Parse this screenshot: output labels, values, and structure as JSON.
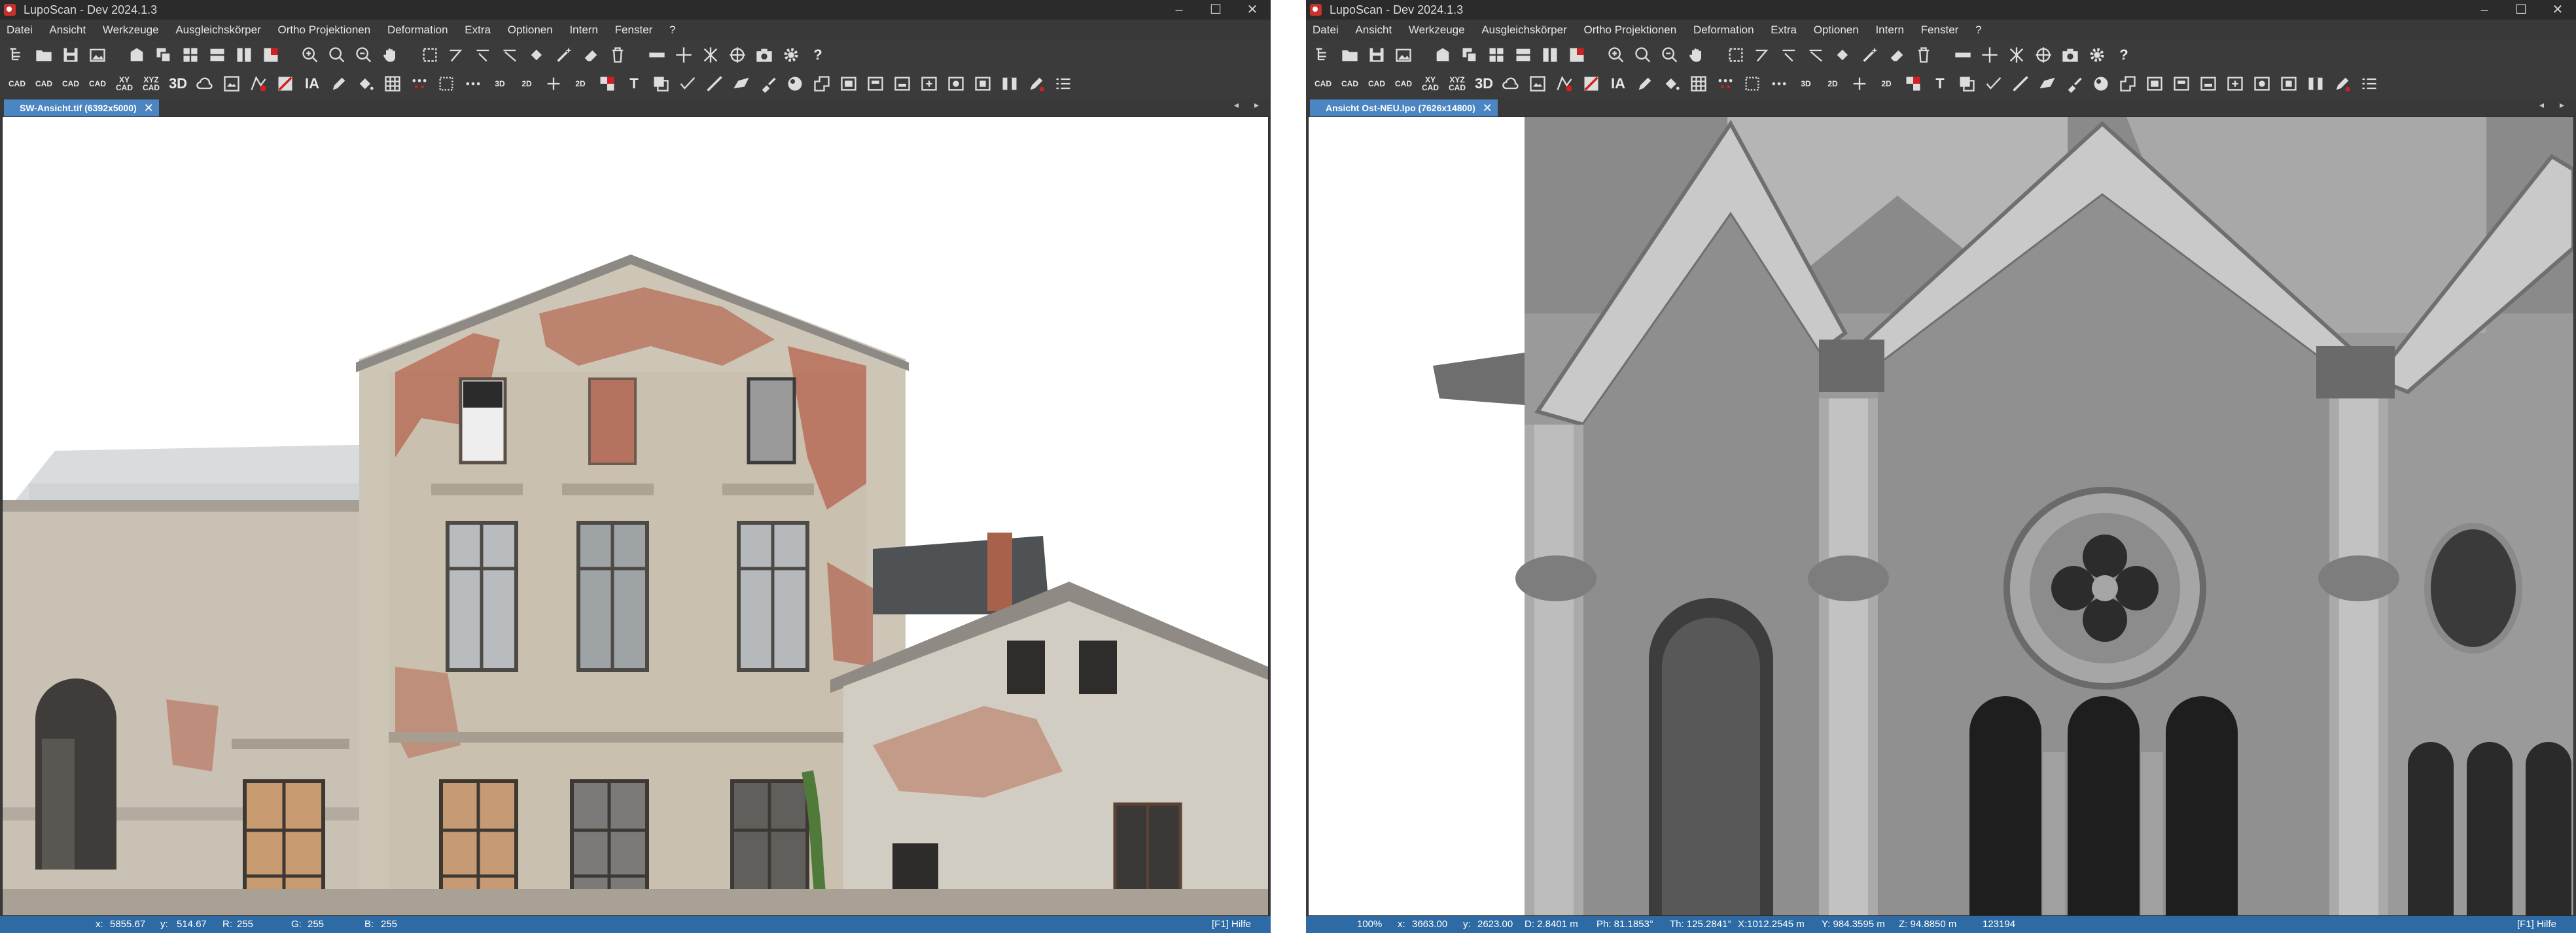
{
  "left": {
    "window_title": "LupoScan - Dev 2024.1.3",
    "menu": [
      "Datei",
      "Ansicht",
      "Werkzeuge",
      "Ausgleichskörper",
      "Ortho Projektionen",
      "Deformation",
      "Extra",
      "Optionen",
      "Intern",
      "Fenster",
      "?"
    ],
    "tab_label": "SW-Ansicht.tif (6392x5000)",
    "status": {
      "x": "x:",
      "x_val": "5855.67",
      "y": "y:",
      "y_val": "514.67",
      "r": "R:",
      "r_val": "255",
      "g": "G:",
      "g_val": "255",
      "b": "B:",
      "b_val": "255",
      "help": "[F1] Hilfe"
    }
  },
  "right": {
    "window_title": "LupoScan - Dev 2024.1.3",
    "menu": [
      "Datei",
      "Ansicht",
      "Werkzeuge",
      "Ausgleichskörper",
      "Ortho Projektionen",
      "Deformation",
      "Extra",
      "Optionen",
      "Intern",
      "Fenster",
      "?"
    ],
    "tab_label": "Ansicht Ost-NEU.lpo (7626x14800)",
    "status": {
      "zoom": "100%",
      "x": "x:",
      "x_val": "3663.00",
      "y": "y:",
      "y_val": "2623.00",
      "d": "D: 2.8401 m",
      "ph": "Ph: 81.1853°",
      "th": "Th: 125.2841°",
      "xm": "X:1012.2545 m",
      "ym": "Y: 984.3595 m",
      "zm": "Z: 94.8850 m",
      "id": "123194",
      "help": "[F1] Hilfe"
    }
  },
  "toolbar": {
    "cad_label": "CAD",
    "xy_label": "XY",
    "xyz_label": "XYZ",
    "three_d": "3D",
    "ia": "IA",
    "question": "?",
    "text_tool": "T",
    "twod": "2D",
    "threed_small": "3D"
  },
  "window_controls": {
    "min": "–",
    "max": "☐",
    "close": "✕",
    "tab_close": "✕",
    "arrows": "◂ ▸"
  },
  "colors": {
    "accent": "#4b86c2",
    "status": "#2e6aa4",
    "chrome": "#393939"
  }
}
